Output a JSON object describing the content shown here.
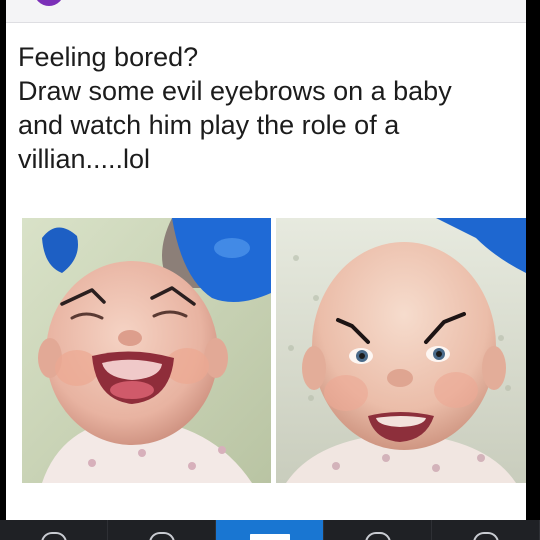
{
  "post": {
    "lines": [
      "Feeling bored?",
      "Draw some evil eyebrows on a baby",
      "and watch him play the role of a",
      "villian.....lol"
    ]
  },
  "photos": {
    "left": {
      "subject": "laughing baby with drawn-on angled eyebrows"
    },
    "right": {
      "subject": "grinning baby with drawn-on villain eyebrows"
    }
  },
  "bottom_nav": {
    "tabs": [
      {
        "icon": "back-icon"
      },
      {
        "icon": "home-icon"
      },
      {
        "icon": "feed-icon",
        "active": true
      },
      {
        "icon": "notifications-icon"
      },
      {
        "icon": "more-icon"
      }
    ]
  },
  "colors": {
    "avatar": "#7b2fb8",
    "active_tab": "#1976d2",
    "nav_background": "#1f2125"
  }
}
